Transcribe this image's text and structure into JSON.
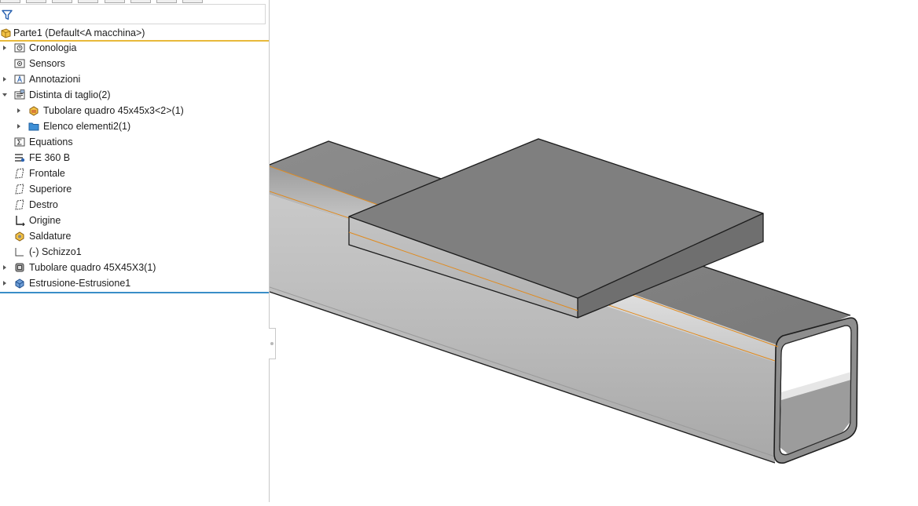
{
  "tree": {
    "root_label": "Parte1 (Default<A macchina>)",
    "items": [
      {
        "label": "Cronologia",
        "icon": "history-folder-icon",
        "arrow": "collapsed",
        "depth": 0
      },
      {
        "label": "Sensors",
        "icon": "sensors-folder-icon",
        "arrow": "none",
        "depth": 0
      },
      {
        "label": "Annotazioni",
        "icon": "annotations-folder-icon",
        "arrow": "collapsed",
        "depth": 0
      },
      {
        "label": "Distinta di taglio(2)",
        "icon": "cut-list-icon",
        "arrow": "expanded",
        "depth": 0
      },
      {
        "label": "Tubolare quadro 45x45x3<2>(1)",
        "icon": "weldment-body-icon",
        "arrow": "collapsed",
        "depth": 1
      },
      {
        "label": "Elenco elementi2(1)",
        "icon": "blue-folder-icon",
        "arrow": "collapsed",
        "depth": 1
      },
      {
        "label": "Equations",
        "icon": "equations-icon",
        "arrow": "none",
        "depth": 0
      },
      {
        "label": "FE 360 B",
        "icon": "material-icon",
        "arrow": "none",
        "depth": 0
      },
      {
        "label": "Frontale",
        "icon": "plane-icon",
        "arrow": "none",
        "depth": 0
      },
      {
        "label": "Superiore",
        "icon": "plane-icon",
        "arrow": "none",
        "depth": 0
      },
      {
        "label": "Destro",
        "icon": "plane-icon",
        "arrow": "none",
        "depth": 0
      },
      {
        "label": "Origine",
        "icon": "origin-icon",
        "arrow": "none",
        "depth": 0
      },
      {
        "label": "Saldature",
        "icon": "weldments-icon",
        "arrow": "none",
        "depth": 0
      },
      {
        "label": "(-) Schizzo1",
        "icon": "sketch-icon",
        "arrow": "none",
        "depth": 0
      },
      {
        "label": "Tubolare quadro 45X45X3(1)",
        "icon": "structural-member-icon",
        "arrow": "collapsed",
        "depth": 0
      },
      {
        "label": "Estrusione-Estrusione1",
        "icon": "extrude-icon",
        "arrow": "collapsed",
        "depth": 0
      }
    ]
  },
  "colors": {
    "root_underline": "#e8b93a",
    "rollback_bar": "#3a8ec8",
    "edge_highlight": "#e08a1e",
    "folder_blue": "#3d8fd6"
  }
}
